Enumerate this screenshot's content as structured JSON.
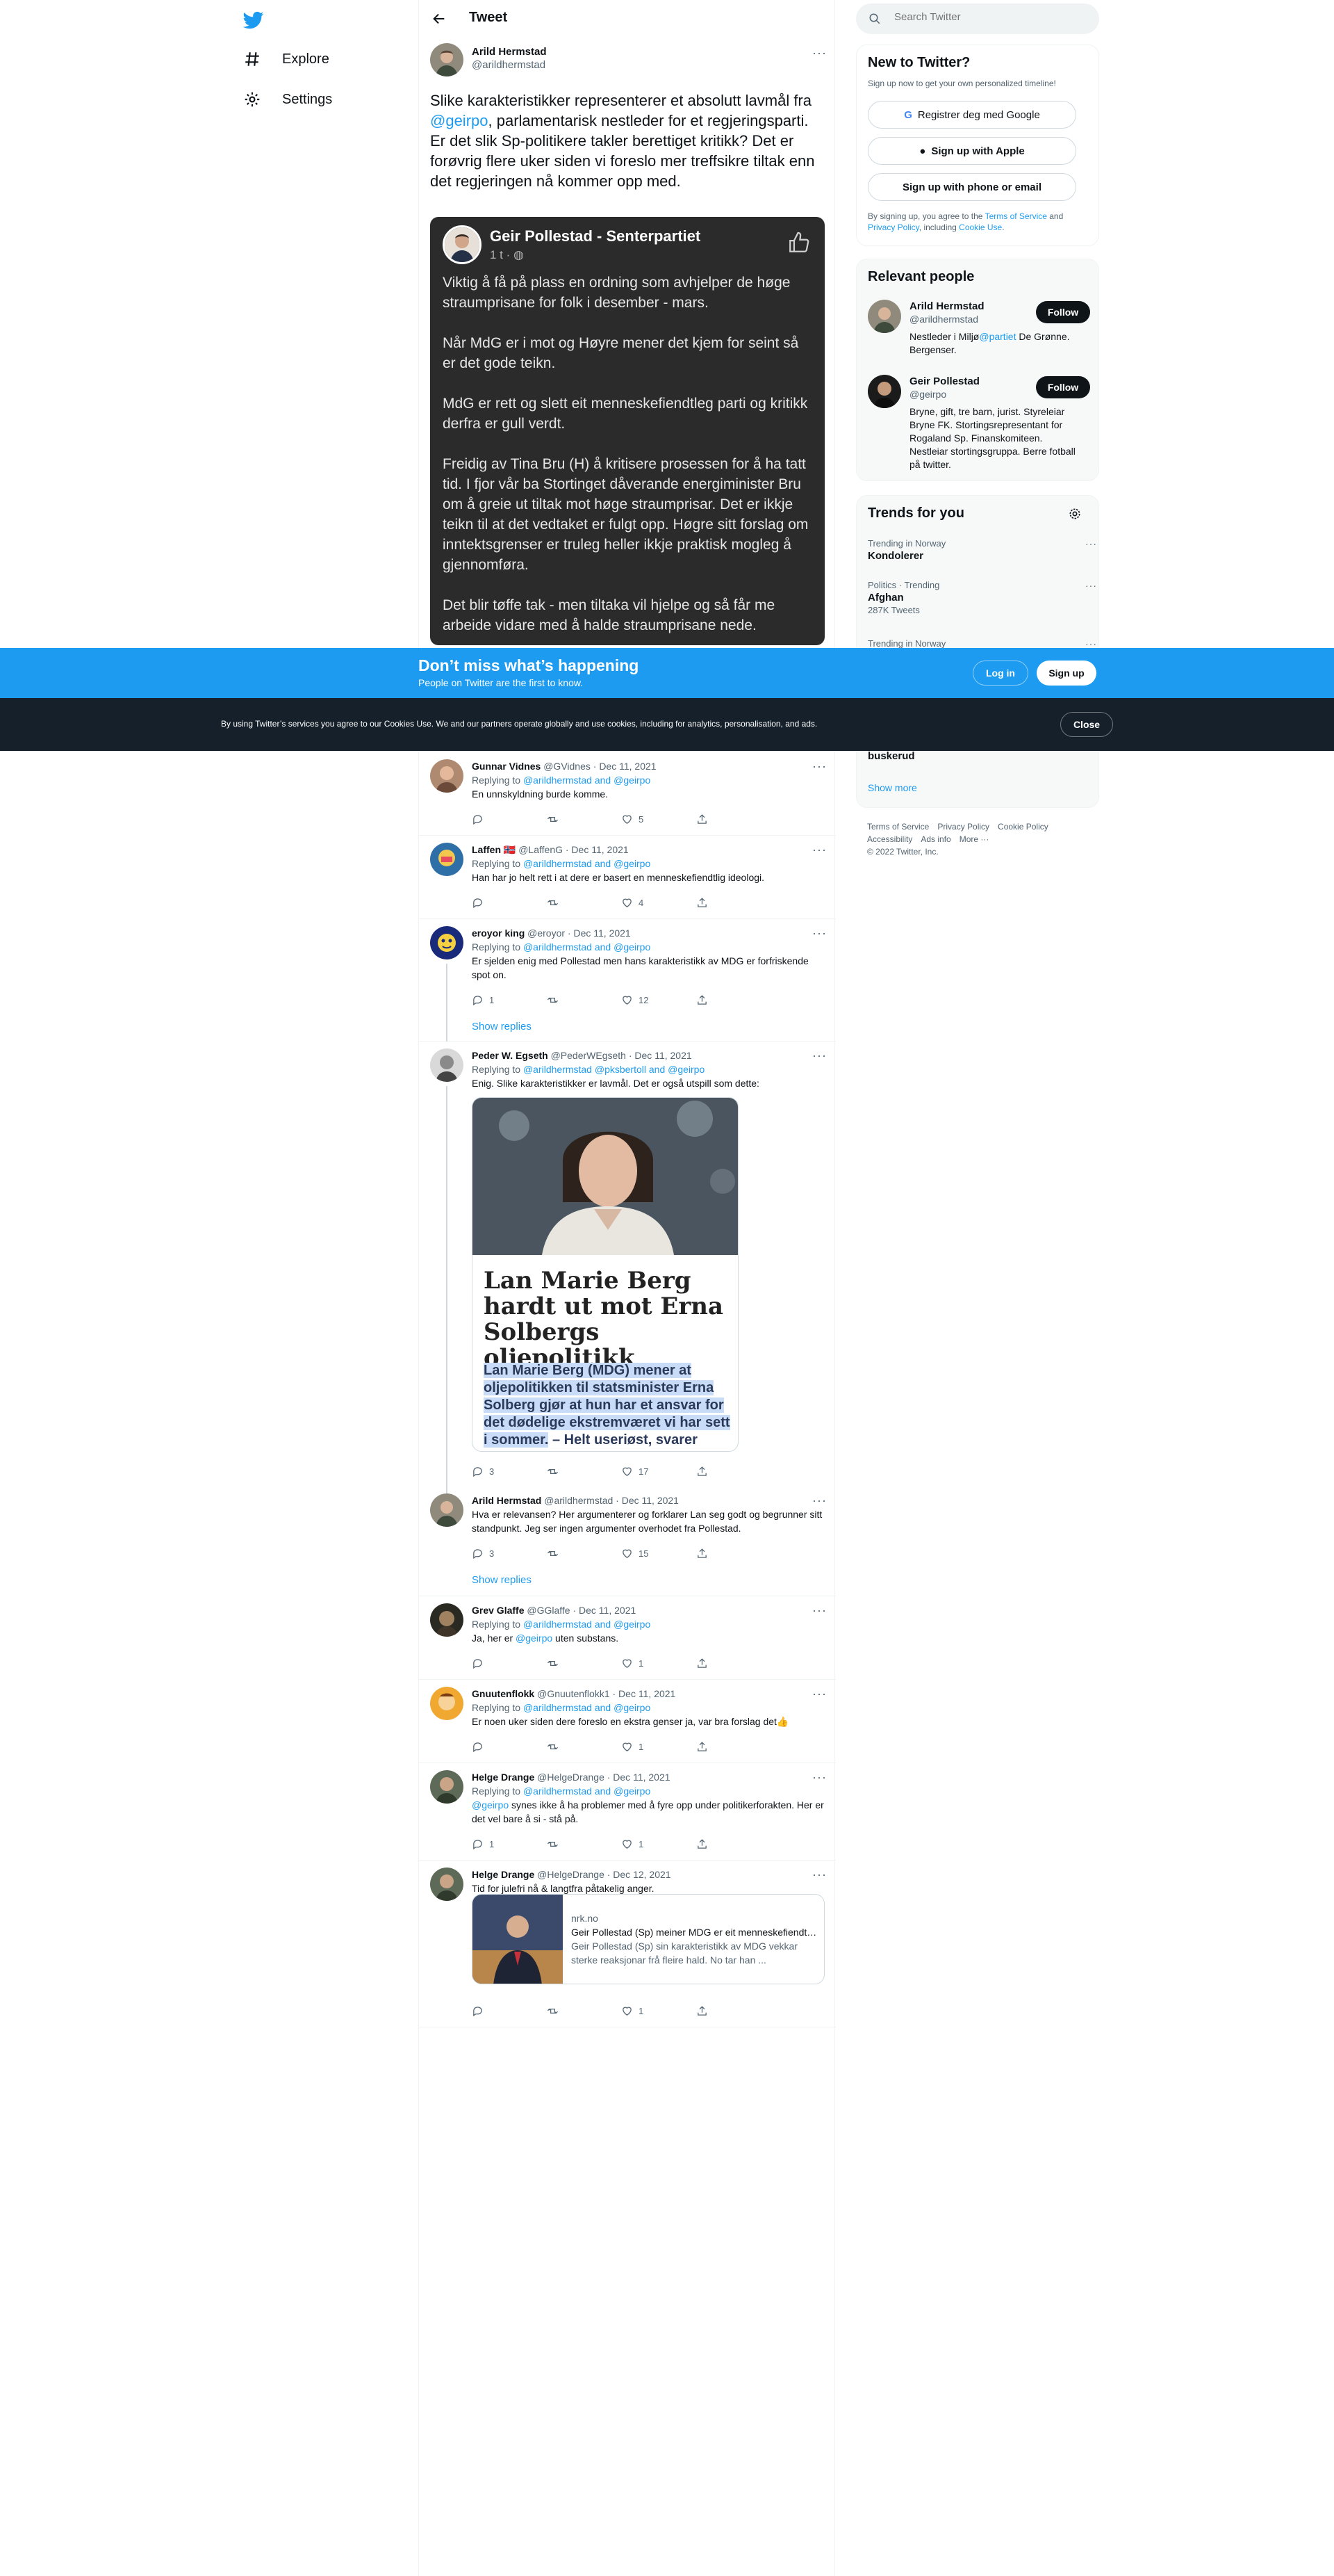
{
  "header": {
    "title": "Tweet"
  },
  "nav": {
    "explore": "Explore",
    "settings": "Settings"
  },
  "main_tweet": {
    "display_name": "Arild Hermstad",
    "handle": "@arildhermstad",
    "text_before": "Slike karakteristikker representerer et absolutt lavmål fra ",
    "mention": "@geirpo",
    "text_after": ", parlamentarisk nestleder for et regjeringsparti. Er det slik Sp-politikere takler berettiget kritikk? Det er forøvrig flere uker siden vi foreslo mer treffsikre tiltak enn det regjeringen nå kommer opp med."
  },
  "embed": {
    "name": "Geir Pollestad - Senterpartiet",
    "time": "1 t ·",
    "paragraphs": [
      "Viktig å få på plass en ordning som avhjelper de høge straumprisane for folk i desember - mars.",
      "Når MdG er i mot og Høyre mener det kjem for seint så er det gode teikn.",
      "MdG er rett og slett eit menneskefiendtleg parti og kritikk derfra er gull verdt.",
      "Freidig av Tina Bru (H) å kritisere prosessen for å ha tatt tid. I fjor vår ba Stortinget dåverande energiminister Bru om å greie ut tiltak mot høge straumprisar. Det er ikkje teikn til at det vedtaket er fulgt opp. Høgre sitt forslag om inntektsgrenser er truleg heller ikkje praktisk mogleg å gjennomføra.",
      "Det blir tøffe tak - men tiltaka vil hjelpe og så får me arbeide vidare med å halde straumprisane nede."
    ]
  },
  "banner": {
    "title": "Don’t miss what’s happening",
    "subtitle": "People on Twitter are the first to know.",
    "login": "Log in",
    "signup": "Sign up"
  },
  "cookie": {
    "text": "By using Twitter’s services you agree to our Cookies Use. We and our partners operate globally and use cookies, including for analytics, personalisation, and ads.",
    "close": "Close"
  },
  "replies": [
    {
      "name": "Gunnar Vidnes",
      "meta": "@GVidnes · Dec 11, 2021",
      "replying_prefix": "Replying to ",
      "replying_to": "@arildhermstad and @geirpo",
      "text": "En unnskyldning burde komme.",
      "counts": {
        "reply": "",
        "retweet": "",
        "like": "5"
      }
    },
    {
      "name": "Laffen 🇳🇴",
      "meta": "@LaffenG · Dec 11, 2021",
      "replying_prefix": "Replying to ",
      "replying_to": "@arildhermstad and @geirpo",
      "text": "Han har jo helt rett i at dere er basert en menneskefiendtlig ideologi.",
      "counts": {
        "reply": "",
        "retweet": "",
        "like": "4"
      }
    },
    {
      "name": "eroyor king",
      "meta": "@eroyor · Dec 11, 2021",
      "replying_prefix": "Replying to ",
      "replying_to": "@arildhermstad and @geirpo",
      "text": "Er sjelden enig med Pollestad men hans karakteristikk av MDG er forfriskende spot on.",
      "counts": {
        "reply": "1",
        "retweet": "",
        "like": "12"
      },
      "show_replies": "Show replies"
    },
    {
      "name": "Peder W. Egseth",
      "meta": "@PederWEgseth · Dec 11, 2021",
      "replying_prefix": "Replying to ",
      "replying_to": "@arildhermstad @pksbertoll and @geirpo",
      "text": "Enig. Slike karakteristikker er lavmål. Det er også utspill som dette:",
      "counts": {
        "reply": "3",
        "retweet": "",
        "like": "17"
      },
      "article": {
        "title": "Lan Marie Berg hardt ut mot Erna Solbergs oljepolitikk",
        "lead_highlight": "Lan Marie Berg (MDG) mener at oljepolitikken til statsminister Erna Solberg gjør at hun har et ansvar for det dødelige ekstremværet vi har sett i sommer.",
        "lead_rest": " – Helt useriøst, svarer"
      }
    },
    {
      "name": "Arild Hermstad",
      "meta": "@arildhermstad · Dec 11, 2021",
      "replying_prefix": "",
      "replying_to": "",
      "text": "Hva er relevansen? Her argumenterer og forklarer Lan seg godt og begrunner sitt standpunkt. Jeg ser ingen argumenter overhodet fra Pollestad.",
      "counts": {
        "reply": "3",
        "retweet": "",
        "like": "15"
      },
      "show_replies": "Show replies"
    },
    {
      "name": "Grev Glaffe",
      "meta": "@GGlaffe · Dec 11, 2021",
      "replying_prefix": "Replying to ",
      "replying_to": "@arildhermstad and @geirpo",
      "text_before": "Ja, her er ",
      "mention": "@geirpo",
      "text_after": " uten substans.",
      "counts": {
        "reply": "",
        "retweet": "",
        "like": "1"
      }
    },
    {
      "name": "Gnuutenflokk",
      "meta": "@Gnuutenflokk1 · Dec 11, 2021",
      "replying_prefix": "Replying to ",
      "replying_to": "@arildhermstad and @geirpo",
      "text": "Er noen uker siden dere foreslo en ekstra genser ja, var bra forslag det👍",
      "counts": {
        "reply": "",
        "retweet": "",
        "like": "1"
      }
    },
    {
      "name": "Helge Drange",
      "meta": "@HelgeDrange · Dec 11, 2021",
      "replying_prefix": "Replying to ",
      "replying_to": "@arildhermstad and @geirpo",
      "mention": "@geirpo",
      "text_after": " synes ikke å ha problemer med å fyre opp under politikerforakten. Her er det vel bare å si - stå på.",
      "counts": {
        "reply": "1",
        "retweet": "",
        "like": "1"
      }
    },
    {
      "name": "Helge Drange",
      "meta": "@HelgeDrange · Dec 12, 2021",
      "replying_prefix": "",
      "replying_to": "",
      "text": "Tid for julefri nå & langtfra påtakelig anger.",
      "counts": {
        "reply": "",
        "retweet": "",
        "like": "1"
      },
      "link": {
        "domain": "nrk.no",
        "title": "Geir Pollestad (Sp) meiner MDG er eit menneskefiendtleg parti",
        "desc": "Geir Pollestad (Sp) sin karakteristikk av MDG vekkar sterke reaksjonar frå fleire hald. No tar han ..."
      }
    }
  ],
  "sidebar": {
    "search_placeholder": "Search Twitter",
    "new": {
      "title": "New to Twitter?",
      "sub": "Sign up now to get your own personalized timeline!",
      "google": "Registrer deg med Google",
      "apple": "Sign up with Apple",
      "phone": "Sign up with phone or email",
      "terms_1": "By signing up, you agree to the ",
      "terms_link": "Terms of Service",
      "terms_2": " and ",
      "privacy_link": "Privacy Policy",
      "terms_3": ", including ",
      "cookie_link": "Cookie Use",
      "terms_4": "."
    },
    "relevant": {
      "title": "Relevant people",
      "people": [
        {
          "name": "Arild Hermstad",
          "handle": "@arildhermstad",
          "bio_before": "Nestleder i Miljø",
          "bio_mention": "@partiet",
          "bio_after": " De Grønne. Bergenser.",
          "follow": "Follow"
        },
        {
          "name": "Geir Pollestad",
          "handle": "@geirpo",
          "bio": "Bryne, gift, tre barn, jurist. Styreleiar Bryne FK. Stortingsrepresentant for Rogaland Sp. Finanskomiteen. Nestleiar stortingsgruppa. Berre fotball på twitter.",
          "follow": "Follow"
        }
      ]
    },
    "trends": {
      "title": "Trends for you",
      "items": [
        {
          "context": "Trending in Norway",
          "name": "Kondolerer",
          "count": ""
        },
        {
          "context": "Politics · Trending",
          "name": "Afghan",
          "count": "287K Tweets"
        },
        {
          "context": "Trending in Norway",
          "name": "",
          "count": ""
        }
      ],
      "partial_name": "buskerud",
      "show_more": "Show more"
    },
    "footer": [
      "Terms of Service",
      "Privacy Policy",
      "Cookie Policy",
      "Accessibility",
      "Ads info",
      "More ···",
      "© 2022 Twitter, Inc."
    ]
  },
  "colors": {
    "accent": "#1d9bf0",
    "text": "#0f1419",
    "muted": "#536471",
    "banner": "#1d9bf0",
    "cookie": "#15202b"
  }
}
